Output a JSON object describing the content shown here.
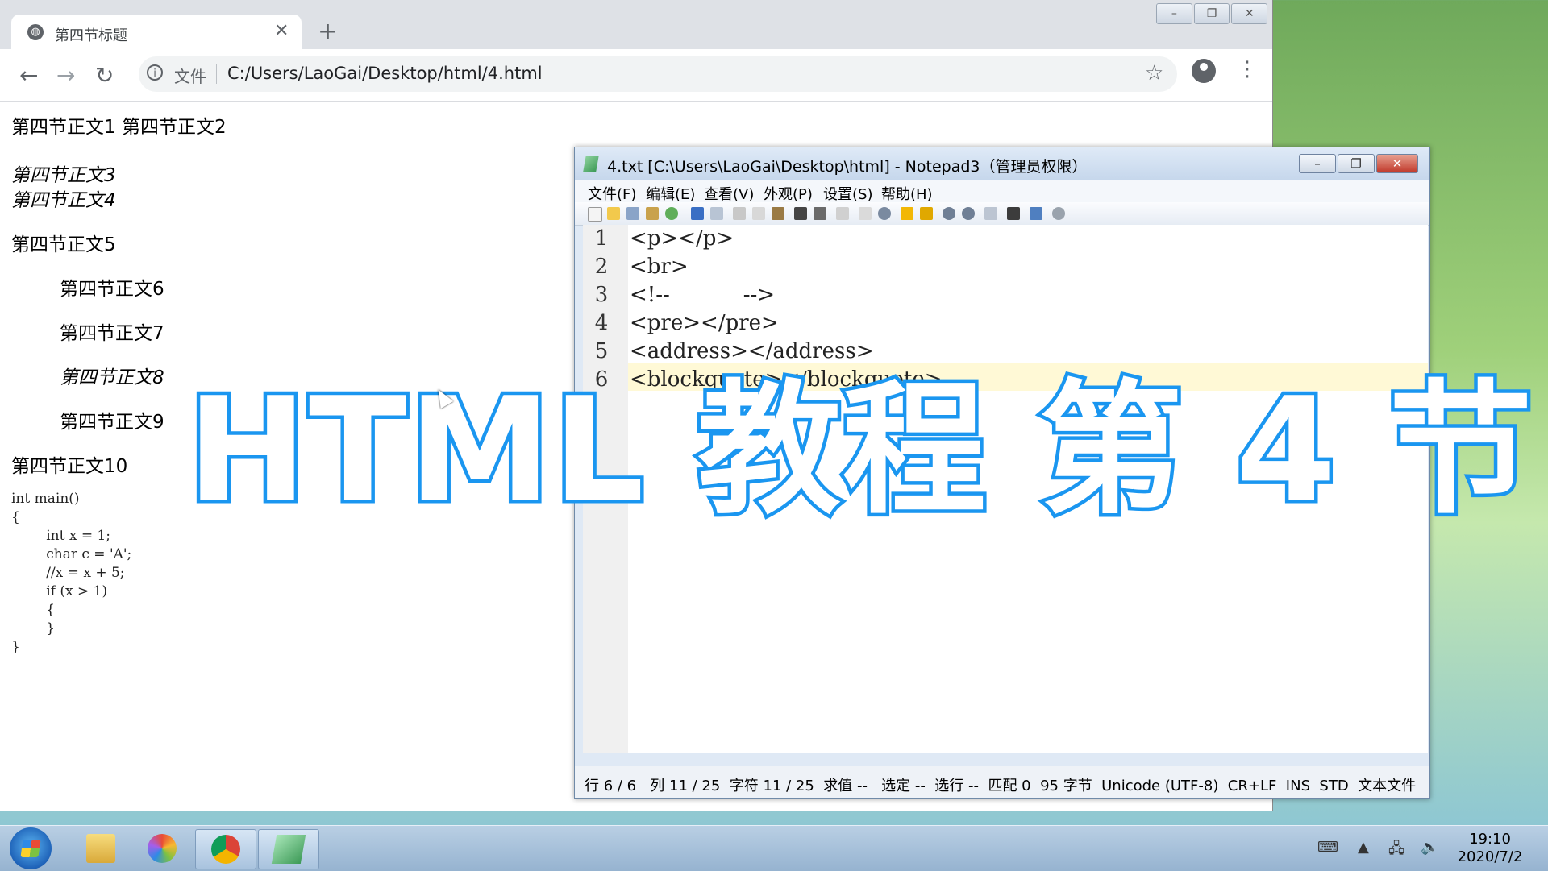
{
  "browser": {
    "tab_title": "第四节标题",
    "tab_close": "✕",
    "new_tab": "+",
    "back": "←",
    "forward": "→",
    "reload": "↻",
    "info_icon": "i",
    "scheme_label": "文件",
    "url": "C:/Users/LaoGai/Desktop/html/4.html",
    "star": "☆",
    "menu": "⋮",
    "win_minimize": "–",
    "win_restore": "❐",
    "win_close": "✕"
  },
  "page": {
    "line1": "第四节正文1 第四节正文2",
    "line3": "第四节正文3",
    "line4": "第四节正文4",
    "line5": "第四节正文5",
    "line6": "第四节正文6",
    "line7": "第四节正文7",
    "line8": "第四节正文8",
    "line9": "第四节正文9",
    "line10": "第四节正文10",
    "pre": [
      "int main()",
      "{",
      "        int x = 1;",
      "        char c = 'A';",
      "        //x = x + 5;",
      "        if (x > 1)",
      "        {",
      "        }",
      "}"
    ]
  },
  "notepad": {
    "title": "4.txt [C:\\Users\\LaoGai\\Desktop\\html] - Notepad3（管理员权限）",
    "menus": [
      "文件(F)",
      "编辑(E)",
      "查看(V)",
      "外观(P)",
      "设置(S)",
      "帮助(H)"
    ],
    "line_numbers": [
      "1",
      "2",
      "3",
      "4",
      "5",
      "6"
    ],
    "lines": [
      "<p></p>",
      "<br>",
      "<!--           -->",
      "<pre></pre>",
      "<address></address>",
      "<blockquote></blockquote>"
    ],
    "status": "行 6 / 6   列 11 / 25  字符 11 / 25  求值 --   选定 --  选行 --  匹配 0  95 字节  Unicode (UTF-8)  CR+LF  INS  STD  文本文件",
    "win_minimize": "–",
    "win_restore": "❐",
    "win_close": "✕"
  },
  "overlay_title": "HTML 教程 第 4 节",
  "taskbar": {
    "time": "19:10",
    "date": "2020/7/2"
  }
}
